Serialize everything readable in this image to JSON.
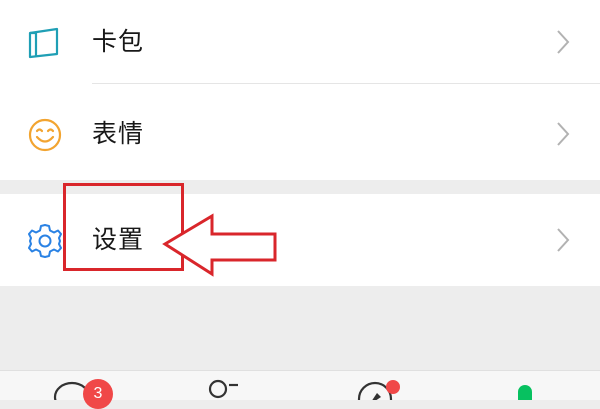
{
  "menu": {
    "items": [
      {
        "label": "卡包",
        "icon": "card-pack-icon"
      },
      {
        "label": "表情",
        "icon": "sticker-smiley-icon"
      },
      {
        "label": "设置",
        "icon": "gear-icon"
      }
    ]
  },
  "tabbar": {
    "chats_badge": "3",
    "discover_has_dot": true,
    "active_tab": "me"
  },
  "colors": {
    "annotation_red": "#d9262b",
    "badge_red": "#f04848",
    "accent_green": "#07c160",
    "card_icon": "#1f9fb5",
    "smiley_icon": "#f2a430",
    "gear_icon": "#2a82e4"
  }
}
